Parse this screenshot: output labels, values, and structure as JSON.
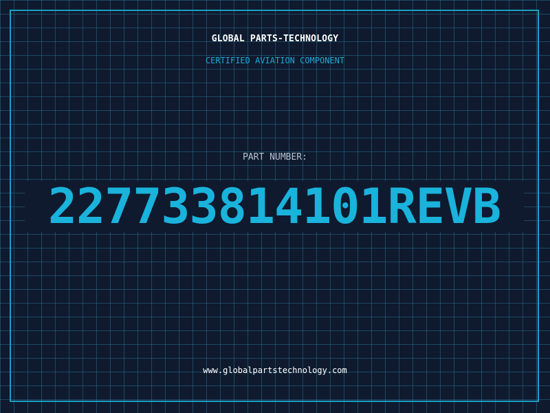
{
  "header": {
    "company_name": "GLOBAL PARTS-TECHNOLOGY",
    "subtitle": "CERTIFIED AVIATION COMPONENT"
  },
  "part": {
    "label": "PART NUMBER:",
    "number": "227733814101REVB"
  },
  "footer": {
    "website": "www.globalpartstechnology.com"
  },
  "colors": {
    "background": "#0f1a2e",
    "grid": "#286e8c",
    "accent": "#19b3dc",
    "frame": "#1b9fc4",
    "text_primary": "#ffffff",
    "text_secondary": "#b8c2d0"
  }
}
